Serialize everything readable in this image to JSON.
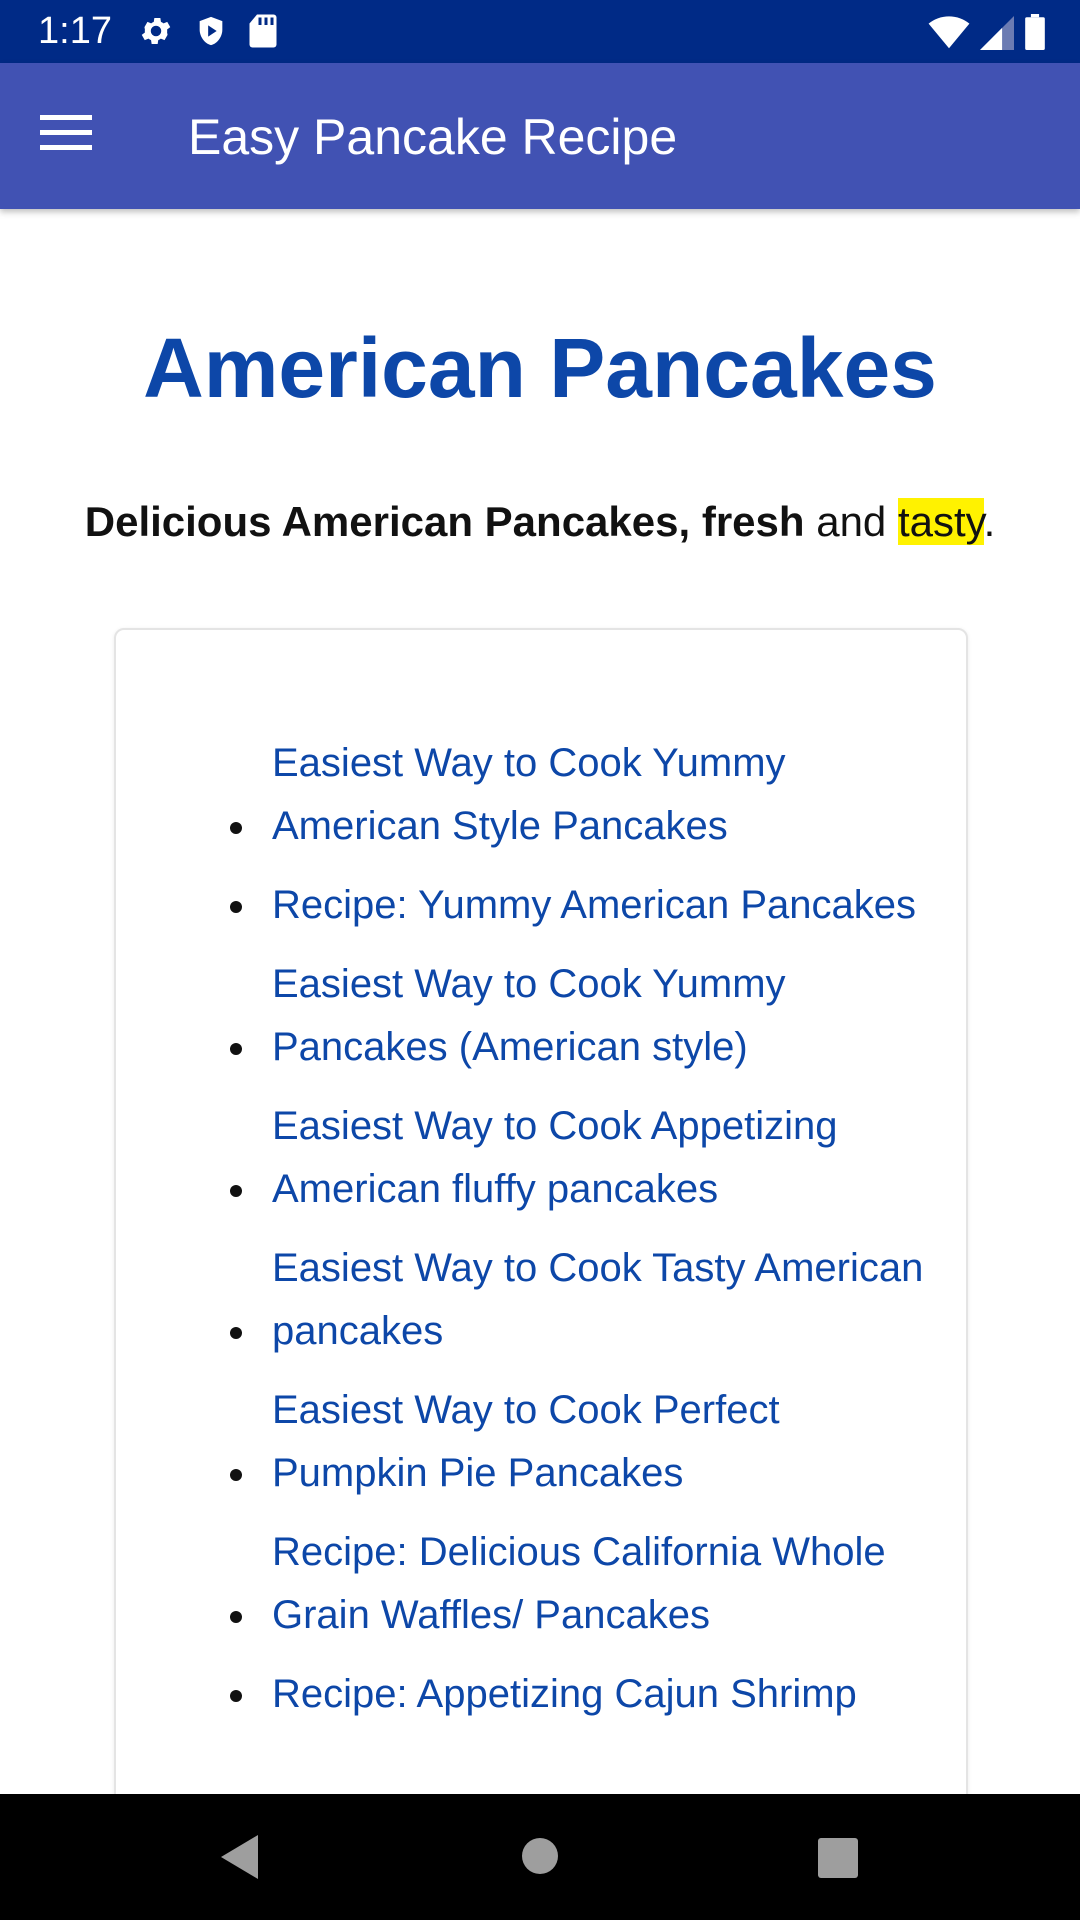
{
  "status_bar": {
    "time": "1:17",
    "left_icons": [
      "gear-icon",
      "shield-icon",
      "sd-card-icon"
    ],
    "right_icons": [
      "wifi-icon",
      "signal-icon",
      "battery-icon"
    ]
  },
  "app_bar": {
    "menu_icon": "hamburger-menu-icon",
    "title": "Easy Pancake Recipe",
    "color": "#4152b3"
  },
  "content": {
    "heading": "American Pancakes",
    "heading_color": "#0d47a8",
    "subtitle": {
      "bold": "Delicious American Pancakes, fresh",
      "plain": " and ",
      "highlighted": "tasty",
      "end": "."
    },
    "recipes": [
      "Easiest Way to Cook Yummy American Style Pancakes",
      "Recipe: Yummy American Pancakes",
      "Easiest Way to Cook Yummy Pancakes (American style)",
      "Easiest Way to Cook Appetizing American fluffy pancakes",
      "Easiest Way to Cook Tasty American pancakes",
      "Easiest Way to Cook Perfect Pumpkin Pie Pancakes",
      "Recipe: Delicious California Whole Grain Waffles/ Pancakes",
      "Recipe: Appetizing Cajun Shrimp"
    ]
  },
  "nav_bar": {
    "buttons": [
      "back-icon",
      "home-icon",
      "recent-apps-icon"
    ]
  }
}
